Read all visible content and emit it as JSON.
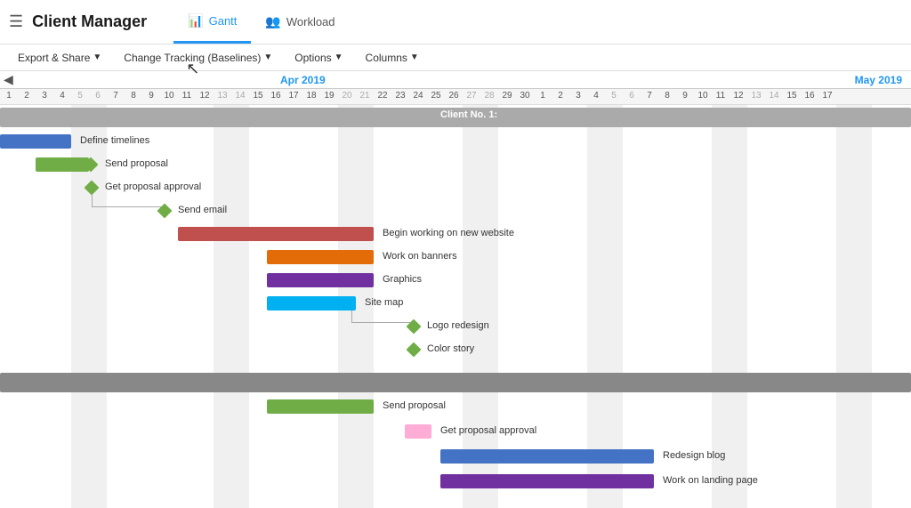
{
  "app": {
    "title": "Client Manager",
    "hamburger": "☰"
  },
  "toolbar": {
    "export_label": "Export & Share",
    "tracking_label": "Change Tracking (Baselines)",
    "options_label": "Options",
    "columns_label": "Columns"
  },
  "views": {
    "gantt_label": "Gantt",
    "workload_label": "Workload"
  },
  "timeline": {
    "apr_label": "Apr 2019",
    "may_label": "May 2019",
    "apr_days": [
      "1",
      "2",
      "3",
      "4",
      "5",
      "6",
      "7",
      "8",
      "9",
      "10",
      "11",
      "12",
      "13",
      "14",
      "15",
      "16",
      "17",
      "18",
      "19",
      "20",
      "21",
      "22",
      "23",
      "24",
      "25",
      "26",
      "27",
      "28",
      "29",
      "30"
    ],
    "may_days": [
      "1",
      "2",
      "3",
      "4",
      "5",
      "6",
      "7",
      "8",
      "9",
      "10",
      "11",
      "12",
      "13",
      "14",
      "15",
      "16",
      "17"
    ]
  },
  "tasks": {
    "client1_label": "Client No. 1:",
    "define_timelines": "Define timelines",
    "send_proposal": "Send proposal",
    "get_proposal_approval": "Get proposal approval",
    "send_email": "Send email",
    "begin_working": "Begin working on new website",
    "work_banners": "Work on banners",
    "graphics": "Graphics",
    "site_map": "Site map",
    "logo_redesign": "Logo redesign",
    "color_story": "Color story",
    "send_proposal2": "Send proposal",
    "get_proposal_approval2": "Get proposal approval",
    "redesign_blog": "Redesign blog",
    "work_landing": "Work on landing page"
  },
  "colors": {
    "blue": "#4472c4",
    "green": "#70ad47",
    "red": "#c0504d",
    "orange": "#e36c09",
    "purple": "#7030a0",
    "teal": "#00b0f0",
    "pink": "#ff99cc",
    "blue2": "#4472c4",
    "purple2": "#7030a0",
    "section_gray": "#888888",
    "accent_blue": "#2196f3"
  }
}
